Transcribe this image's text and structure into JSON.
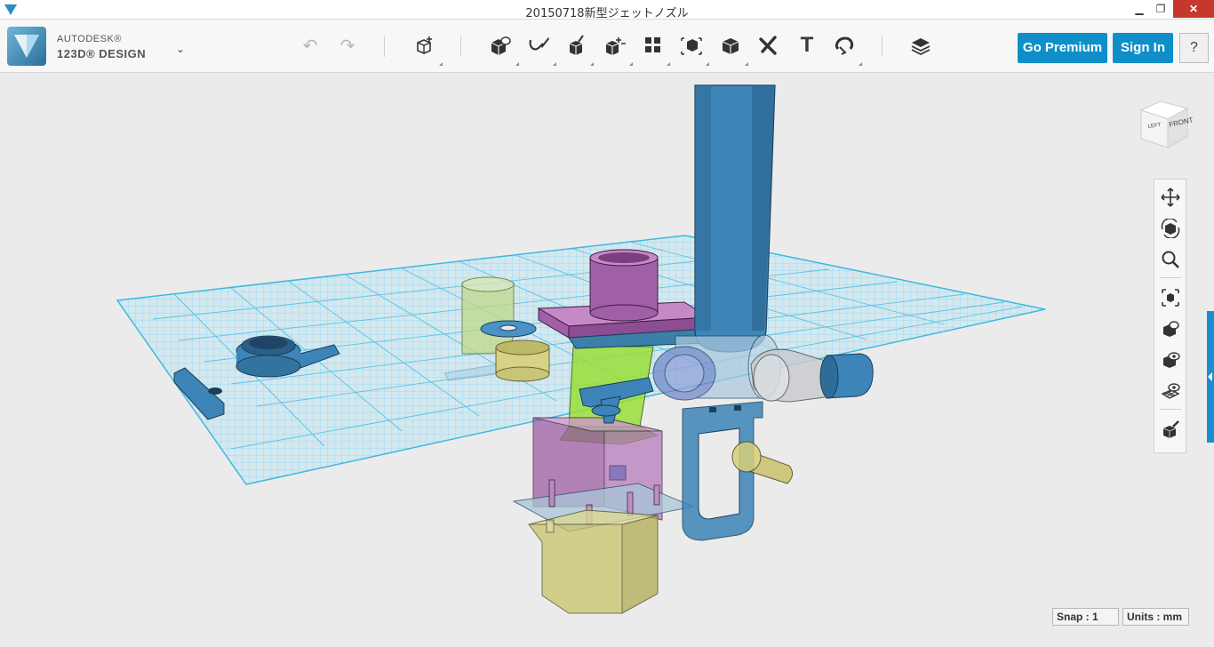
{
  "window": {
    "title": "20150718新型ジェットノズル",
    "minimize_glyph": "▁",
    "maximize_glyph": "❐",
    "close_glyph": "✕"
  },
  "app": {
    "brand_line1": "AUTODESK®",
    "brand_line2": "123D® DESIGN",
    "menu_chevron": "⌄"
  },
  "toolbar": {
    "undo_icon": "↶",
    "redo_icon": "↷",
    "tools": [
      {
        "name": "transform-icon"
      },
      {
        "name": "primitives-icon"
      },
      {
        "name": "sketch-icon"
      },
      {
        "name": "construct-icon"
      },
      {
        "name": "modify-icon"
      },
      {
        "name": "pattern-icon"
      },
      {
        "name": "group-icon"
      },
      {
        "name": "combine-icon"
      },
      {
        "name": "measure-icon"
      },
      {
        "name": "text-icon"
      },
      {
        "name": "snap-icon"
      },
      {
        "name": "material-icon"
      }
    ],
    "text_tool_glyph": "T"
  },
  "account": {
    "premium_label": "Go Premium",
    "signin_label": "Sign In",
    "help_label": "?"
  },
  "viewcube": {
    "left_label": "LEFT",
    "front_label": "FRONT"
  },
  "navigation": [
    "pan-icon",
    "orbit-icon",
    "zoom-icon",
    "fit-icon",
    "view-mode-icon",
    "visibility-icon",
    "grid-visibility-icon",
    "material-preview-icon"
  ],
  "status": {
    "snap": "Snap : 1",
    "units": "Units : mm"
  },
  "colors": {
    "accent": "#0f8fc9",
    "close": "#c7382c",
    "grid": "#3fb8e0",
    "part_blue": "#3d84b8",
    "part_purple": "#a05fa6",
    "part_green": "#9adf3a",
    "part_yellow": "#c9c36b",
    "part_grey": "#c9ccd0"
  }
}
